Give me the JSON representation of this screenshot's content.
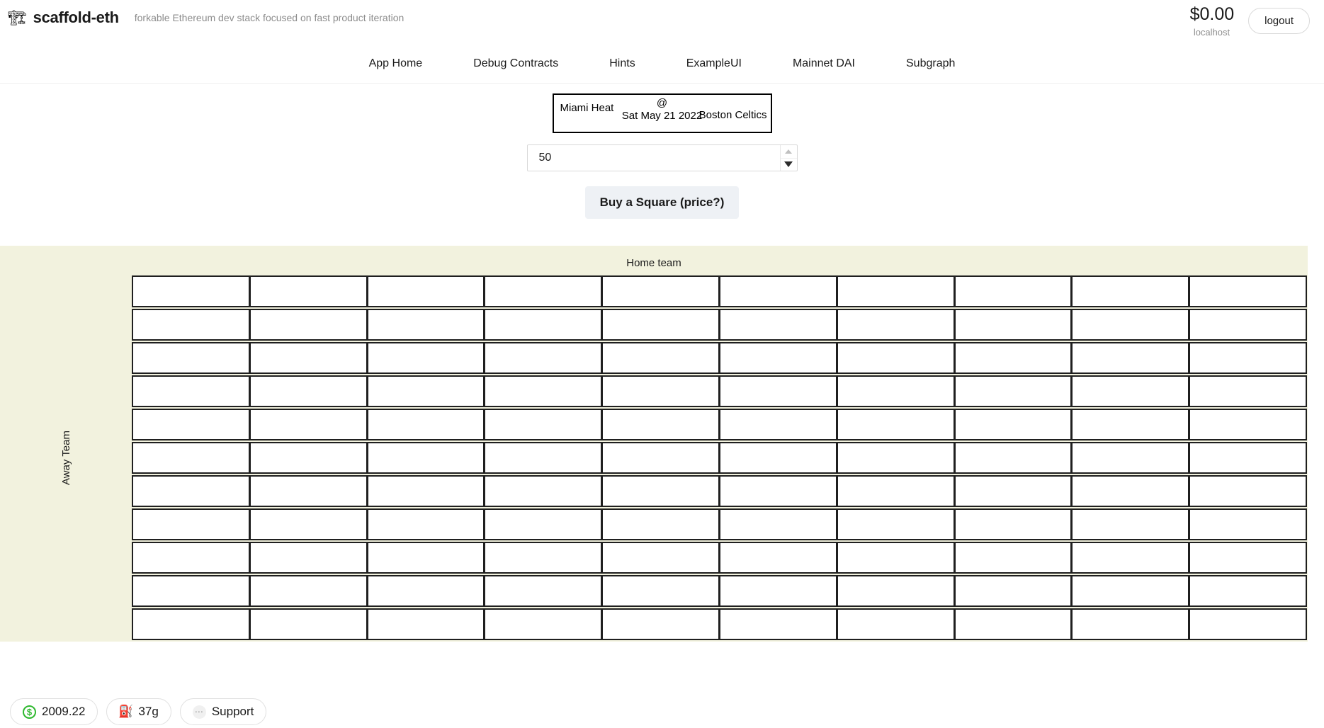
{
  "header": {
    "brand_icon": "crane-icon",
    "brand_title": "scaffold-eth",
    "tagline": "forkable Ethereum dev stack focused on fast product iteration",
    "balance": "$0.00",
    "network": "localhost",
    "logout_label": "logout"
  },
  "nav": {
    "items": [
      {
        "label": "App Home"
      },
      {
        "label": "Debug Contracts"
      },
      {
        "label": "Hints"
      },
      {
        "label": "ExampleUI"
      },
      {
        "label": "Mainnet DAI"
      },
      {
        "label": "Subgraph"
      }
    ]
  },
  "matchup": {
    "away_team": "Miami Heat",
    "at_symbol": "@",
    "date": "Sat May 21 2022",
    "home_team": "Boston Celtics"
  },
  "purchase": {
    "amount_value": "50",
    "amount_placeholder": "50",
    "spinner_up": "▲",
    "spinner_down": "▼",
    "buy_label": "Buy a Square (price?)"
  },
  "board": {
    "home_label": "Home team",
    "away_label": "Away Team",
    "rows": 11,
    "columns": 10,
    "background_color": "#f2f2de",
    "cell_border_color": "#1f1f1f",
    "cell_fill_color": "#ffffff",
    "cells": [
      [
        "",
        "",
        "",
        "",
        "",
        "",
        "",
        "",
        "",
        ""
      ],
      [
        "",
        "",
        "",
        "",
        "",
        "",
        "",
        "",
        "",
        ""
      ],
      [
        "",
        "",
        "",
        "",
        "",
        "",
        "",
        "",
        "",
        ""
      ],
      [
        "",
        "",
        "",
        "",
        "",
        "",
        "",
        "",
        "",
        ""
      ],
      [
        "",
        "",
        "",
        "",
        "",
        "",
        "",
        "",
        "",
        ""
      ],
      [
        "",
        "",
        "",
        "",
        "",
        "",
        "",
        "",
        "",
        ""
      ],
      [
        "",
        "",
        "",
        "",
        "",
        "",
        "",
        "",
        "",
        ""
      ],
      [
        "",
        "",
        "",
        "",
        "",
        "",
        "",
        "",
        "",
        ""
      ],
      [
        "",
        "",
        "",
        "",
        "",
        "",
        "",
        "",
        "",
        ""
      ],
      [
        "",
        "",
        "",
        "",
        "",
        "",
        "",
        "",
        "",
        ""
      ],
      [
        "",
        "",
        "",
        "",
        "",
        "",
        "",
        "",
        "",
        ""
      ]
    ]
  },
  "bottom_bar": {
    "price": "2009.22",
    "price_icon": "dollar-circle-icon",
    "gas": "37g",
    "gas_icon": "gas-pump-icon",
    "support": "Support",
    "support_icon": "ellipsis-bubble-icon"
  },
  "colors": {
    "board_bg": "#f2f2de",
    "button_bg": "#eef1f5",
    "muted_text": "#8c8c8c",
    "price_green": "#2eb82e",
    "gas_red": "#e8453c"
  }
}
